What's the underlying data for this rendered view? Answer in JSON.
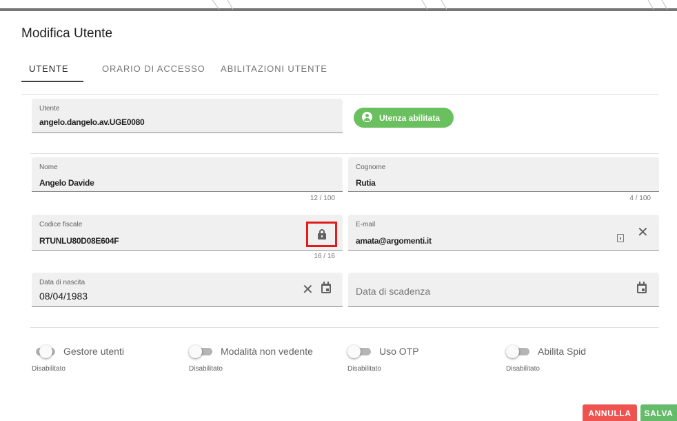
{
  "dialog": {
    "title": "Modifica Utente"
  },
  "tabs": [
    {
      "label": "UTENTE"
    },
    {
      "label": "ORARIO DI ACCESSO"
    },
    {
      "label": "ABILITAZIONI UTENTE"
    }
  ],
  "active_tab": "UTENTE",
  "fields": {
    "utente": {
      "label": "Utente",
      "value": "angelo.dangelo.av.UGE0080"
    },
    "status_badge": {
      "label": "Utenza abilitata",
      "color": "#6abf5e"
    },
    "nome": {
      "label": "Nome",
      "value": "Angelo Davide",
      "counter": "12 / 100"
    },
    "cognome": {
      "label": "Cognome",
      "value": "Rutia",
      "counter": "4 / 100"
    },
    "codice_fiscale": {
      "label": "Codice fiscale",
      "value": "RTUNLU80D08E604F",
      "counter": "16 / 16"
    },
    "email": {
      "label": "E-mail",
      "value": "amata@argomenti.it"
    },
    "data_nascita": {
      "label": "Data di nascita",
      "value": "08/04/1983"
    },
    "data_scadenza": {
      "placeholder": "Data di scadenza"
    }
  },
  "toggles": [
    {
      "label": "Gestore utenti",
      "status": "Disabilitato"
    },
    {
      "label": "Modalità non vedente",
      "status": "Disabilitato"
    },
    {
      "label": "Uso OTP",
      "status": "Disabilitato"
    },
    {
      "label": "Abilita Spid",
      "status": "Disabilitato"
    }
  ],
  "actions": {
    "cancel": "ANNULLA",
    "save": "SALVA"
  },
  "colors": {
    "cancel": "#ef5350",
    "save": "#66bb6a",
    "highlight": "#e31b1b"
  }
}
